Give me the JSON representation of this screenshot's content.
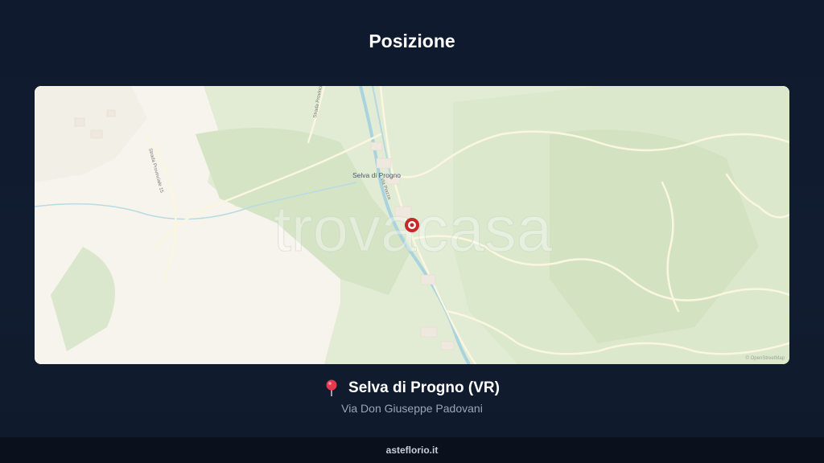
{
  "header": {
    "title": "Posizione"
  },
  "map": {
    "place_label": "Selva di Progno",
    "road_labels": [
      "Strada Provinciale 14",
      "Strada Provinciale 15",
      "Via Piazza"
    ],
    "watermark": "trovacasa",
    "attribution": "© OpenStreetMap"
  },
  "location": {
    "name": "Selva di Progno (VR)",
    "address": "Via Don Giuseppe Padovani",
    "pin_icon": "round-pushpin-icon"
  },
  "footer": {
    "brand": "asteflorio.it"
  },
  "colors": {
    "background": "#111c30",
    "map_green": "#e1ecd3",
    "map_plain": "#f8f4ee",
    "river": "#a9d3de",
    "marker": "#c62828"
  }
}
